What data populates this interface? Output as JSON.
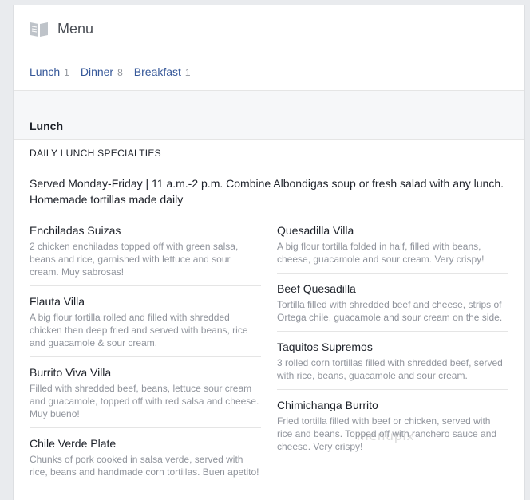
{
  "header": {
    "title": "Menu",
    "icon": "book-icon"
  },
  "tabs": [
    {
      "label": "Lunch",
      "count": "1"
    },
    {
      "label": "Dinner",
      "count": "8"
    },
    {
      "label": "Breakfast",
      "count": "1"
    }
  ],
  "section": {
    "title": "Lunch",
    "subsection": "DAILY LUNCH SPECIALTIES",
    "description": "Served Monday-Friday | 11 a.m.-2 p.m. Combine Albondigas soup or fresh salad with any lunch. Homemade tortillas made daily"
  },
  "items_left": [
    {
      "name": "Enchiladas Suizas",
      "desc": "2 chicken enchiladas topped off with green salsa, beans and rice, garnished with lettuce and sour cream. Muy sabrosas!"
    },
    {
      "name": "Flauta Villa",
      "desc": "A big flour tortilla rolled and filled with shredded chicken then deep fried and served with beans, rice and guacamole & sour cream."
    },
    {
      "name": "Burrito Viva Villa",
      "desc": "Filled with shredded beef, beans, lettuce sour cream and guacamole, topped off with red salsa and cheese. Muy bueno!"
    },
    {
      "name": "Chile Verde Plate",
      "desc": "Chunks of pork cooked in salsa verde, served with rice, beans and handmade corn tortillas. Buen apetito!"
    }
  ],
  "items_right": [
    {
      "name": "Quesadilla Villa",
      "desc": "A big flour tortilla folded in half, filled with beans, cheese, guacamole and sour cream. Very crispy!"
    },
    {
      "name": "Beef Quesadilla",
      "desc": "Tortilla filled with shredded beef and cheese, strips of Ortega chile, guacamole and sour cream on the side."
    },
    {
      "name": "Taquitos Supremos",
      "desc": "3 rolled corn tortillas filled with shredded beef, served with rice, beans, guacamole and sour cream."
    },
    {
      "name": "Chimichanga Burrito",
      "desc": "Fried tortilla filled with beef or chicken, served with rice and beans. Topped off with ranchero sauce and cheese. Very crispy!"
    }
  ],
  "watermark": "menupix"
}
